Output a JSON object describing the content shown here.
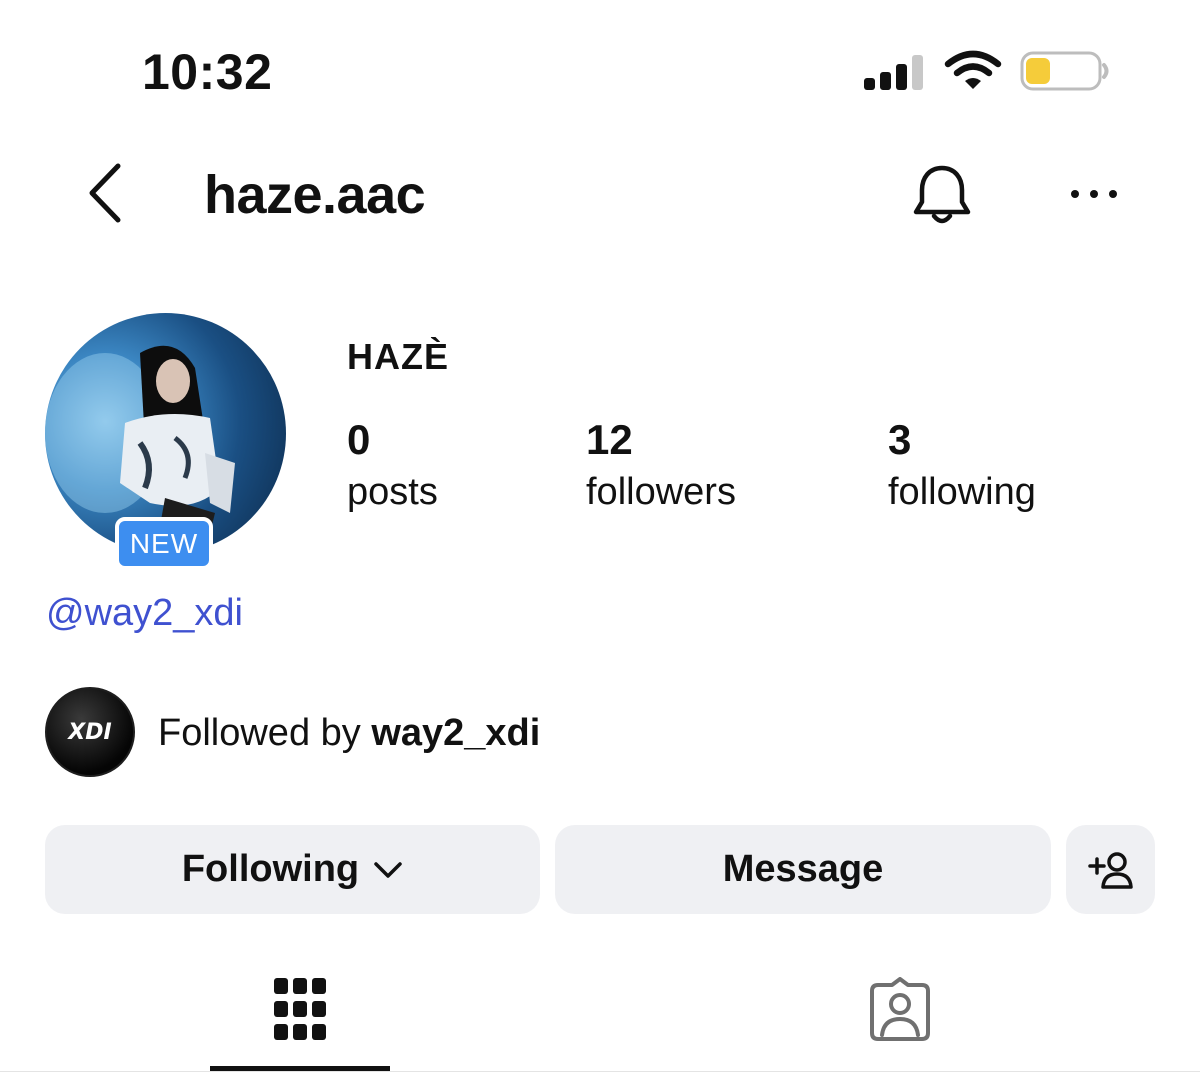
{
  "status_bar": {
    "time": "10:32",
    "signal_icon": "cellular-signal-icon",
    "wifi_icon": "wifi-icon",
    "battery_icon": "battery-low-icon",
    "battery_color": "#f5cc3a"
  },
  "header": {
    "back_icon": "chevron-left-icon",
    "username": "haze.aac",
    "notifications_icon": "bell-icon",
    "more_icon": "more-horizontal-icon"
  },
  "profile": {
    "display_name": "HAZÈ",
    "avatar_badge": "NEW",
    "mention": "@way2_xdi",
    "stats": {
      "posts": {
        "value": "0",
        "label": "posts"
      },
      "followers": {
        "value": "12",
        "label": "followers"
      },
      "following": {
        "value": "3",
        "label": "following"
      }
    }
  },
  "followed_by": {
    "avatar_text": "XDI",
    "prefix": "Followed by",
    "account": "way2_xdi"
  },
  "actions": {
    "following_label": "Following",
    "following_icon": "chevron-down-icon",
    "message_label": "Message",
    "add_user_icon": "add-person-icon"
  },
  "tabs": [
    {
      "icon": "grid-icon",
      "active": true
    },
    {
      "icon": "tagged-person-icon",
      "active": false
    }
  ],
  "colors": {
    "mention": "#3f51d0",
    "badge": "#3d8ef0",
    "button_bg": "#eff0f3"
  }
}
